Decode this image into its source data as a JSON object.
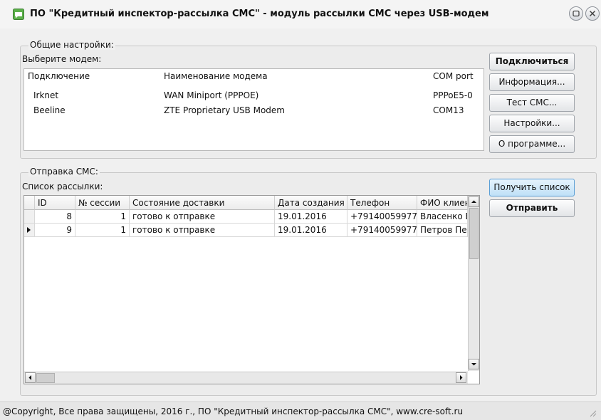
{
  "window": {
    "title": "ПО \"Кредитный инспектор-рассылка СМС\" - модуль рассылки СМС через USB-модем"
  },
  "settings": {
    "legend": "Общие настройки:",
    "select_modem_label": "Выберите модем:",
    "columns": [
      "Подключение",
      "Наименование модема",
      "COM port"
    ],
    "modems": [
      {
        "connection": "Irknet",
        "name": "WAN Miniport (PPPOE)",
        "port": "PPPoE5-0"
      },
      {
        "connection": "Beeline",
        "name": "ZTE Proprietary USB Modem",
        "port": "COM13"
      }
    ]
  },
  "buttons": {
    "connect": "Подключиться",
    "info": "Информация...",
    "test_sms": "Тест СМС...",
    "settings": "Настройки...",
    "about": "О программе...",
    "get_list": "Получить список",
    "send": "Отправить"
  },
  "sms": {
    "legend": "Отправка СМС:",
    "list_label": "Список рассылки:",
    "columns": [
      "ID",
      "№ сессии",
      "Состояние доставки",
      "Дата создания",
      "Телефон",
      "ФИО клиен"
    ],
    "rows": [
      {
        "id": "8",
        "session": "1",
        "status": "готово к отправке",
        "date": "19.01.2016",
        "phone": "+79140059977",
        "fio": "Власенко Е"
      },
      {
        "id": "9",
        "session": "1",
        "status": "готово к отправке",
        "date": "19.01.2016",
        "phone": "+79140059977",
        "fio": "Петров Пе"
      }
    ],
    "current_row": 1
  },
  "footer": {
    "copyright": "@Copyright, Все права защищены, 2016 г., ПО \"Кредитный инспектор-рассылка СМС\", www.cre-soft.ru"
  }
}
